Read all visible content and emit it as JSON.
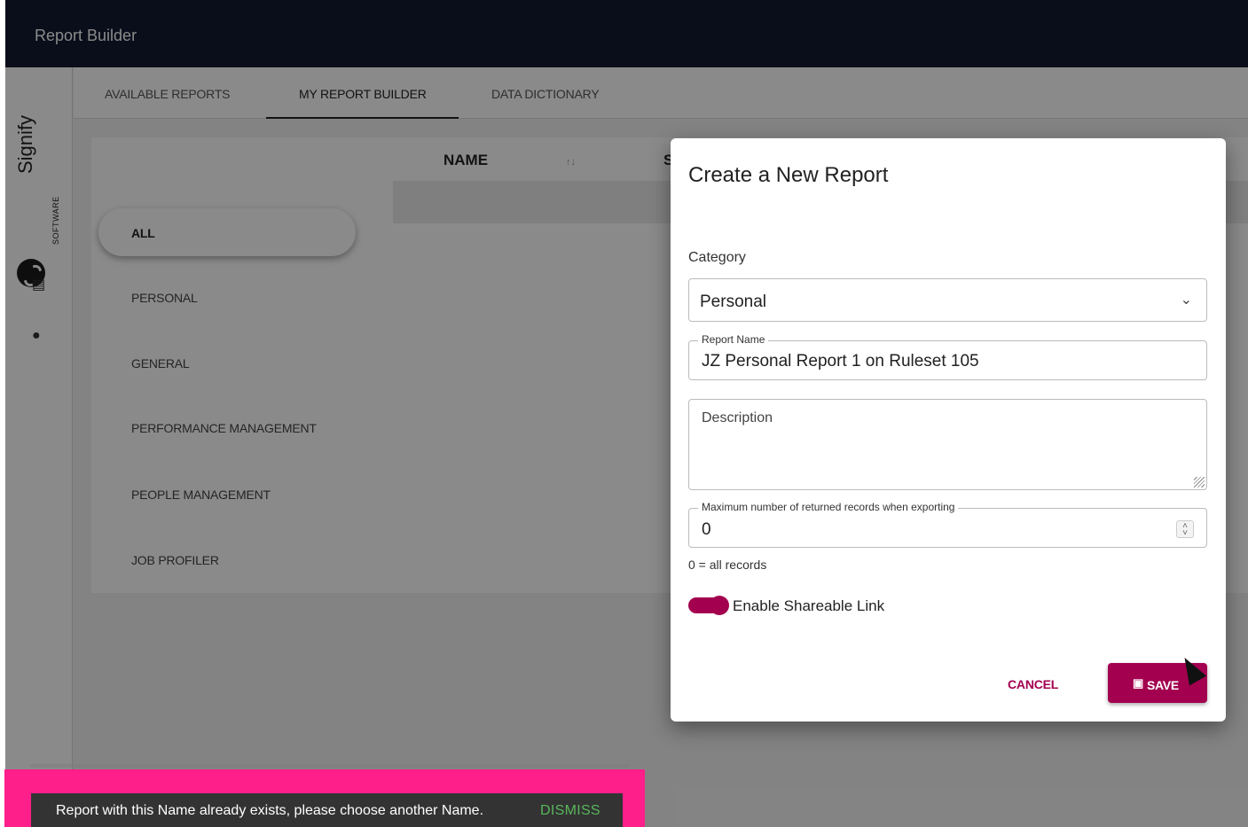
{
  "app": {
    "title": "Report Builder"
  },
  "brand": {
    "logo_text": "Signify",
    "logo_sub": "SOFTWARE",
    "accent": "#a3004f",
    "topbar_bg": "#131a33",
    "highlight": "#ff1f8a"
  },
  "rail": {
    "icons": [
      "bar-chart-icon",
      "person-icon"
    ]
  },
  "tabs": [
    {
      "label": "AVAILABLE REPORTS"
    },
    {
      "label": "MY REPORT BUILDER",
      "active": true
    },
    {
      "label": "DATA DICTIONARY"
    }
  ],
  "categories": {
    "selected": "ALL",
    "items": [
      "PERSONAL",
      "GENERAL",
      "PERFORMANCE MANAGEMENT",
      "PEOPLE MANAGEMENT",
      "JOB PROFILER"
    ]
  },
  "table": {
    "columns": [
      "NAME",
      "S"
    ],
    "sort_glyph": "↑↓"
  },
  "modal": {
    "title": "Create a New Report",
    "category_label": "Category",
    "category_value": "Personal",
    "report_name_label": "Report Name",
    "report_name_value": "JZ Personal Report 1 on Ruleset 105",
    "description_placeholder": "Description",
    "max_records_label": "Maximum number of returned records when exporting",
    "max_records_value": "0",
    "max_records_hint": "0 = all records",
    "shareable_label": "Enable Shareable Link",
    "shareable_enabled": true,
    "cancel_label": "CANCEL",
    "save_label": "SAVE"
  },
  "snackbar": {
    "message": "Report with this Name already exists, please choose another Name.",
    "action": "DISMISS"
  }
}
